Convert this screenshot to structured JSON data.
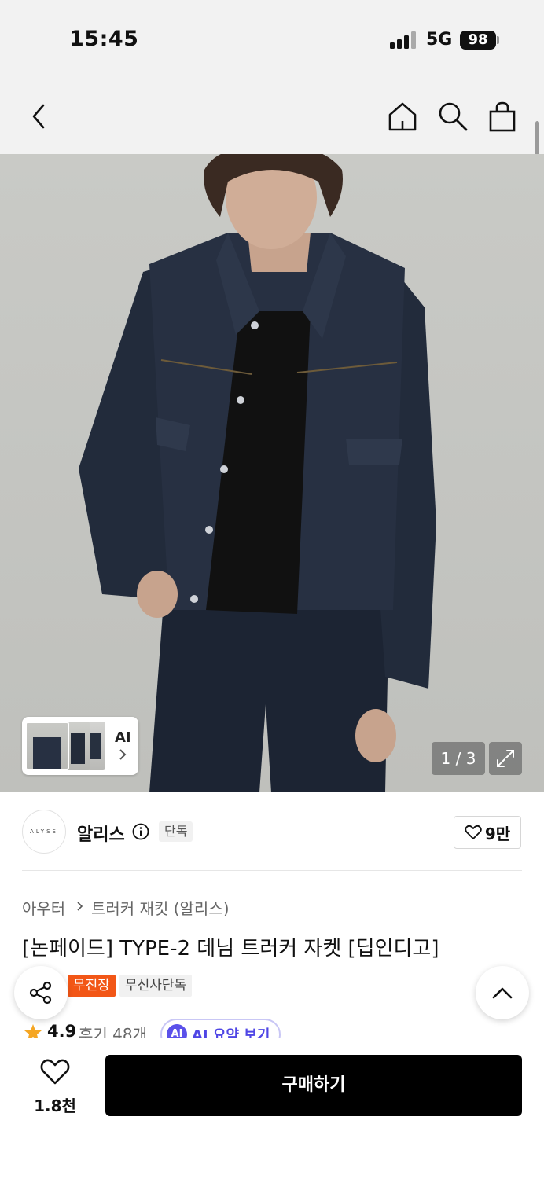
{
  "status_bar": {
    "time": "15:45",
    "network": "5G",
    "battery": "98"
  },
  "nav": {
    "back_icon": "chevron-left-icon",
    "home_icon": "home-icon",
    "search_icon": "search-icon",
    "cart_icon": "shopping-bag-icon"
  },
  "gallery": {
    "ai_label": "AI",
    "page_counter": "1 / 3",
    "expand_icon": "expand-icon"
  },
  "brand": {
    "logo_text": "ALYSS",
    "name": "알리스",
    "exclusive_badge": "단독",
    "like_count": "9만"
  },
  "product": {
    "breadcrumb": [
      "아우터",
      "트러커 재킷 (알리스)"
    ],
    "title": "[논페이드] TYPE-2 데님 트러커 자켓 [딥인디고]",
    "tags": [
      "무진장",
      "무신사단독"
    ],
    "rating": "4.9",
    "review_count": "후기 48개",
    "ai_summary_label": "AI 요약 보기",
    "ai_badge": "AI"
  },
  "bottom_bar": {
    "wish_count": "1.8천",
    "buy_label": "구매하기"
  },
  "colors": {
    "accent_red": "#f25616",
    "ai_purple": "#5b51ea",
    "buy_bg": "#000000",
    "star": "#f5a623"
  }
}
